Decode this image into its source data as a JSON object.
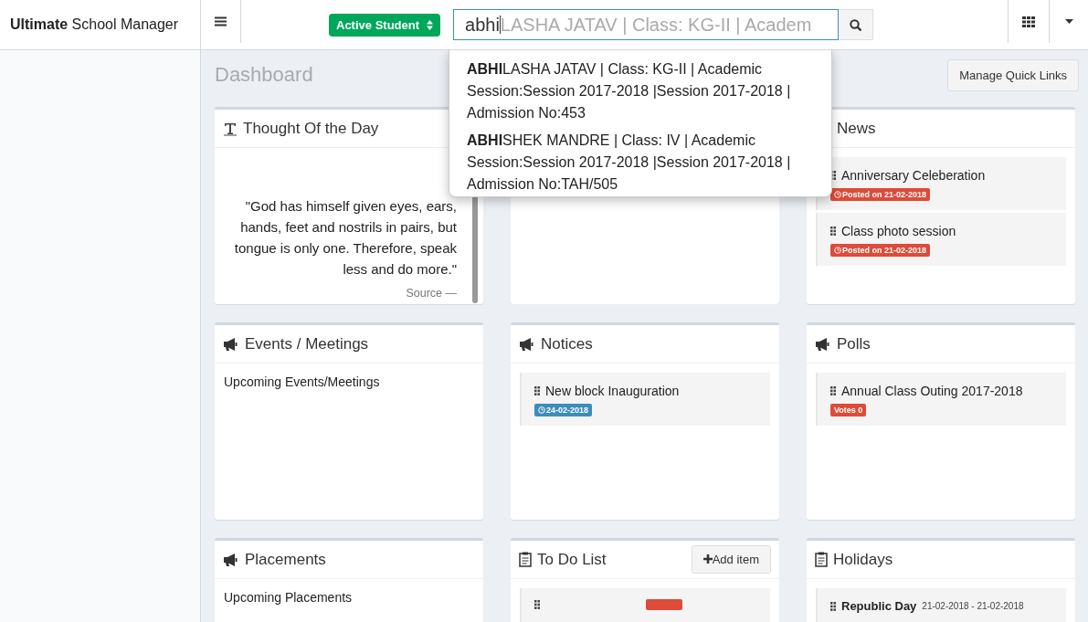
{
  "header": {
    "logo": "**Ultimate** School Manager",
    "filter": {
      "label": "Active Student"
    },
    "search": {
      "value": "abhi",
      "hint": "LASHA JATAV | Class: KG-II | Academ"
    }
  },
  "suggestions": [
    {
      "text": "**ABHI**LASHA JATAV | Class: KG-II | Academic Session:Session 2017-2018 |Session 2017-2018 | Admission No:453"
    },
    {
      "text": "**ABHI**SHEK MANDRE | Class: IV | Academic Session:Session 2017-2018 |Session 2017-2018 | Admission No:TAH/505"
    }
  ],
  "page": {
    "title": "Dashboard",
    "quick_links_button": "Manage Quick Links"
  },
  "panels": [
    {
      "kind": "quote",
      "title": "Thought Of the Day",
      "quote": "\"God has himself given eyes, ears, hands, feet and nostrils in pairs, but tongue is only one. Therefore, speak less and do more.\"",
      "source": "Source —"
    },
    {
      "kind": "blank"
    },
    {
      "kind": "list",
      "title": "News",
      "icon_covered": true,
      "items": [
        {
          "title": "Anniversary Celeberation",
          "badge": "Posted on 21-02-2018",
          "clock": true,
          "color": "#dd4b39"
        },
        {
          "title": "Class photo session",
          "badge": "Posted on 21-02-2018",
          "clock": true,
          "color": "#dd4b39"
        }
      ]
    },
    {
      "kind": "text",
      "title": "Events / Meetings",
      "text": "Upcoming Events/Meetings"
    },
    {
      "kind": "list",
      "title": "Notices",
      "items": [
        {
          "title": "New block Inauguration",
          "badge": "24-02-2018",
          "clock": true,
          "color": "#3c8dbc"
        }
      ]
    },
    {
      "kind": "list",
      "title": "Polls",
      "items": [
        {
          "title": "Annual Class Outing 2017-2018",
          "badge": "Votes 0",
          "clock": false,
          "color": "#dd4b39"
        }
      ]
    },
    {
      "kind": "text",
      "title": "Placements",
      "text": "Upcoming Placements"
    },
    {
      "kind": "todo",
      "title": "To Do List",
      "button": "Add item"
    },
    {
      "kind": "holidays",
      "title": "Holidays",
      "items": [
        {
          "name": "Republic Day",
          "dates": "21-02-2018 - 21-02-2018"
        }
      ]
    }
  ]
}
